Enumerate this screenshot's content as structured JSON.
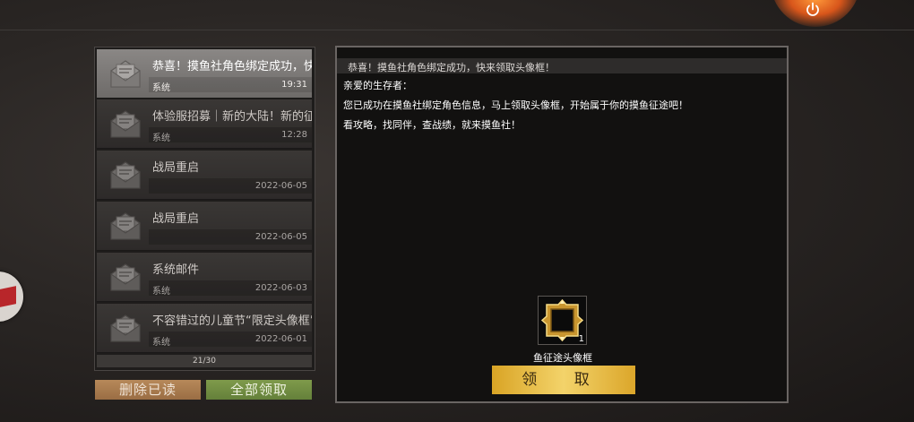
{
  "mail_list": {
    "items": [
      {
        "title": "恭喜！摸鱼社角色绑定成功，快",
        "sender": "系统",
        "time": "19:31",
        "active": true
      },
      {
        "title": "体验服招募｜新的大陆！新的征",
        "sender": "系统",
        "time": "12:28",
        "active": false
      },
      {
        "title": "战局重启",
        "sender": "",
        "time": "2022-06-05",
        "active": false
      },
      {
        "title": "战局重启",
        "sender": "",
        "time": "2022-06-05",
        "active": false
      },
      {
        "title": "系统邮件",
        "sender": "系统",
        "time": "2022-06-03",
        "active": false
      },
      {
        "title": "不容错过的儿童节“限定头像框”",
        "sender": "系统",
        "time": "2022-06-01",
        "active": false
      }
    ],
    "counter": "21/30"
  },
  "buttons": {
    "delete_read": "删除已读",
    "claim_all": "全部领取"
  },
  "detail": {
    "header": "恭喜！摸鱼社角色绑定成功，快来领取头像框！",
    "greeting": "亲爱的生存者：",
    "body_line1": "您已成功在摸鱼社绑定角色信息，马上领取头像框，开始属于你的摸鱼征途吧！",
    "body_line2": "看攻略，找同伴，查战绩，就来摸鱼社！",
    "reward": {
      "name": "鱼征途头像框",
      "count": "1",
      "icon": "golden-avatar-frame-icon"
    },
    "receive_button": "领 取"
  },
  "icons": {
    "power": "power-icon",
    "envelope": "open-envelope-icon"
  },
  "colors": {
    "accent_gold": "#f3d36a",
    "delete": "#9a6d44",
    "claim": "#64803a",
    "power": "#d8561b"
  }
}
